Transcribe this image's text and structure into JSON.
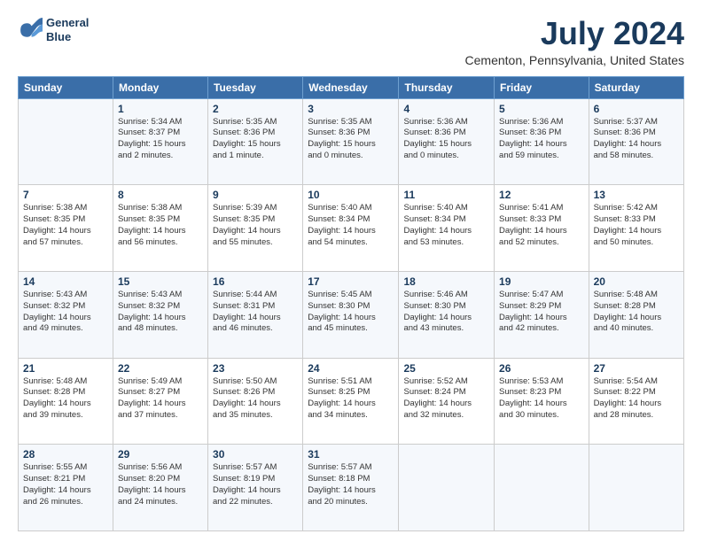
{
  "logo": {
    "line1": "General",
    "line2": "Blue"
  },
  "title": "July 2024",
  "subtitle": "Cementon, Pennsylvania, United States",
  "header_days": [
    "Sunday",
    "Monday",
    "Tuesday",
    "Wednesday",
    "Thursday",
    "Friday",
    "Saturday"
  ],
  "weeks": [
    [
      {
        "day": "",
        "content": ""
      },
      {
        "day": "1",
        "content": "Sunrise: 5:34 AM\nSunset: 8:37 PM\nDaylight: 15 hours\nand 2 minutes."
      },
      {
        "day": "2",
        "content": "Sunrise: 5:35 AM\nSunset: 8:36 PM\nDaylight: 15 hours\nand 1 minute."
      },
      {
        "day": "3",
        "content": "Sunrise: 5:35 AM\nSunset: 8:36 PM\nDaylight: 15 hours\nand 0 minutes."
      },
      {
        "day": "4",
        "content": "Sunrise: 5:36 AM\nSunset: 8:36 PM\nDaylight: 15 hours\nand 0 minutes."
      },
      {
        "day": "5",
        "content": "Sunrise: 5:36 AM\nSunset: 8:36 PM\nDaylight: 14 hours\nand 59 minutes."
      },
      {
        "day": "6",
        "content": "Sunrise: 5:37 AM\nSunset: 8:36 PM\nDaylight: 14 hours\nand 58 minutes."
      }
    ],
    [
      {
        "day": "7",
        "content": "Sunrise: 5:38 AM\nSunset: 8:35 PM\nDaylight: 14 hours\nand 57 minutes."
      },
      {
        "day": "8",
        "content": "Sunrise: 5:38 AM\nSunset: 8:35 PM\nDaylight: 14 hours\nand 56 minutes."
      },
      {
        "day": "9",
        "content": "Sunrise: 5:39 AM\nSunset: 8:35 PM\nDaylight: 14 hours\nand 55 minutes."
      },
      {
        "day": "10",
        "content": "Sunrise: 5:40 AM\nSunset: 8:34 PM\nDaylight: 14 hours\nand 54 minutes."
      },
      {
        "day": "11",
        "content": "Sunrise: 5:40 AM\nSunset: 8:34 PM\nDaylight: 14 hours\nand 53 minutes."
      },
      {
        "day": "12",
        "content": "Sunrise: 5:41 AM\nSunset: 8:33 PM\nDaylight: 14 hours\nand 52 minutes."
      },
      {
        "day": "13",
        "content": "Sunrise: 5:42 AM\nSunset: 8:33 PM\nDaylight: 14 hours\nand 50 minutes."
      }
    ],
    [
      {
        "day": "14",
        "content": "Sunrise: 5:43 AM\nSunset: 8:32 PM\nDaylight: 14 hours\nand 49 minutes."
      },
      {
        "day": "15",
        "content": "Sunrise: 5:43 AM\nSunset: 8:32 PM\nDaylight: 14 hours\nand 48 minutes."
      },
      {
        "day": "16",
        "content": "Sunrise: 5:44 AM\nSunset: 8:31 PM\nDaylight: 14 hours\nand 46 minutes."
      },
      {
        "day": "17",
        "content": "Sunrise: 5:45 AM\nSunset: 8:30 PM\nDaylight: 14 hours\nand 45 minutes."
      },
      {
        "day": "18",
        "content": "Sunrise: 5:46 AM\nSunset: 8:30 PM\nDaylight: 14 hours\nand 43 minutes."
      },
      {
        "day": "19",
        "content": "Sunrise: 5:47 AM\nSunset: 8:29 PM\nDaylight: 14 hours\nand 42 minutes."
      },
      {
        "day": "20",
        "content": "Sunrise: 5:48 AM\nSunset: 8:28 PM\nDaylight: 14 hours\nand 40 minutes."
      }
    ],
    [
      {
        "day": "21",
        "content": "Sunrise: 5:48 AM\nSunset: 8:28 PM\nDaylight: 14 hours\nand 39 minutes."
      },
      {
        "day": "22",
        "content": "Sunrise: 5:49 AM\nSunset: 8:27 PM\nDaylight: 14 hours\nand 37 minutes."
      },
      {
        "day": "23",
        "content": "Sunrise: 5:50 AM\nSunset: 8:26 PM\nDaylight: 14 hours\nand 35 minutes."
      },
      {
        "day": "24",
        "content": "Sunrise: 5:51 AM\nSunset: 8:25 PM\nDaylight: 14 hours\nand 34 minutes."
      },
      {
        "day": "25",
        "content": "Sunrise: 5:52 AM\nSunset: 8:24 PM\nDaylight: 14 hours\nand 32 minutes."
      },
      {
        "day": "26",
        "content": "Sunrise: 5:53 AM\nSunset: 8:23 PM\nDaylight: 14 hours\nand 30 minutes."
      },
      {
        "day": "27",
        "content": "Sunrise: 5:54 AM\nSunset: 8:22 PM\nDaylight: 14 hours\nand 28 minutes."
      }
    ],
    [
      {
        "day": "28",
        "content": "Sunrise: 5:55 AM\nSunset: 8:21 PM\nDaylight: 14 hours\nand 26 minutes."
      },
      {
        "day": "29",
        "content": "Sunrise: 5:56 AM\nSunset: 8:20 PM\nDaylight: 14 hours\nand 24 minutes."
      },
      {
        "day": "30",
        "content": "Sunrise: 5:57 AM\nSunset: 8:19 PM\nDaylight: 14 hours\nand 22 minutes."
      },
      {
        "day": "31",
        "content": "Sunrise: 5:57 AM\nSunset: 8:18 PM\nDaylight: 14 hours\nand 20 minutes."
      },
      {
        "day": "",
        "content": ""
      },
      {
        "day": "",
        "content": ""
      },
      {
        "day": "",
        "content": ""
      }
    ]
  ]
}
